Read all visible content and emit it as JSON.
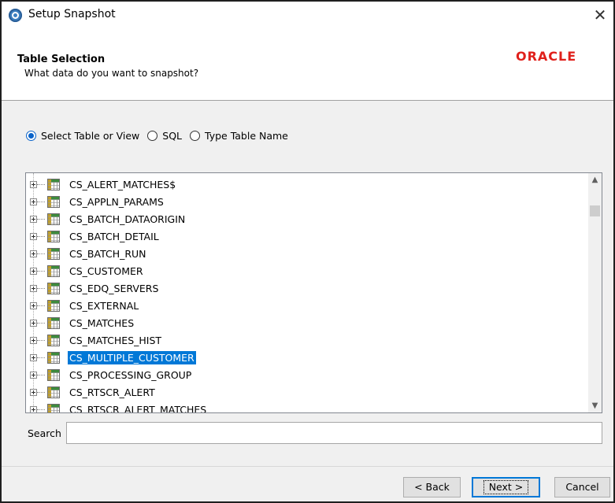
{
  "window": {
    "title": "Setup Snapshot",
    "close_icon": "close-icon",
    "app_icon": "app-icon"
  },
  "header": {
    "title": "Table Selection",
    "subtitle": "What data do you want to snapshot?",
    "logo": "ORACLE"
  },
  "source_options": [
    {
      "label": "Select Table or View",
      "checked": true
    },
    {
      "label": "SQL",
      "checked": false
    },
    {
      "label": "Type Table Name",
      "checked": false
    }
  ],
  "tables": [
    {
      "name": "CS_ALERT_MATCHES$",
      "selected": false
    },
    {
      "name": "CS_APPLN_PARAMS",
      "selected": false
    },
    {
      "name": "CS_BATCH_DATAORIGIN",
      "selected": false
    },
    {
      "name": "CS_BATCH_DETAIL",
      "selected": false
    },
    {
      "name": "CS_BATCH_RUN",
      "selected": false
    },
    {
      "name": "CS_CUSTOMER",
      "selected": false
    },
    {
      "name": "CS_EDQ_SERVERS",
      "selected": false
    },
    {
      "name": "CS_EXTERNAL",
      "selected": false
    },
    {
      "name": "CS_MATCHES",
      "selected": false
    },
    {
      "name": "CS_MATCHES_HIST",
      "selected": false
    },
    {
      "name": "CS_MULTIPLE_CUSTOMER",
      "selected": true
    },
    {
      "name": "CS_PROCESSING_GROUP",
      "selected": false
    },
    {
      "name": "CS_RTSCR_ALERT",
      "selected": false
    },
    {
      "name": "CS_RTSCR_ALERT_MATCHES",
      "selected": false
    }
  ],
  "search": {
    "label": "Search",
    "value": ""
  },
  "buttons": {
    "back": "< Back",
    "next": "Next >",
    "cancel": "Cancel"
  },
  "colors": {
    "selection": "#0078d7",
    "oracle_red": "#e0201b"
  }
}
